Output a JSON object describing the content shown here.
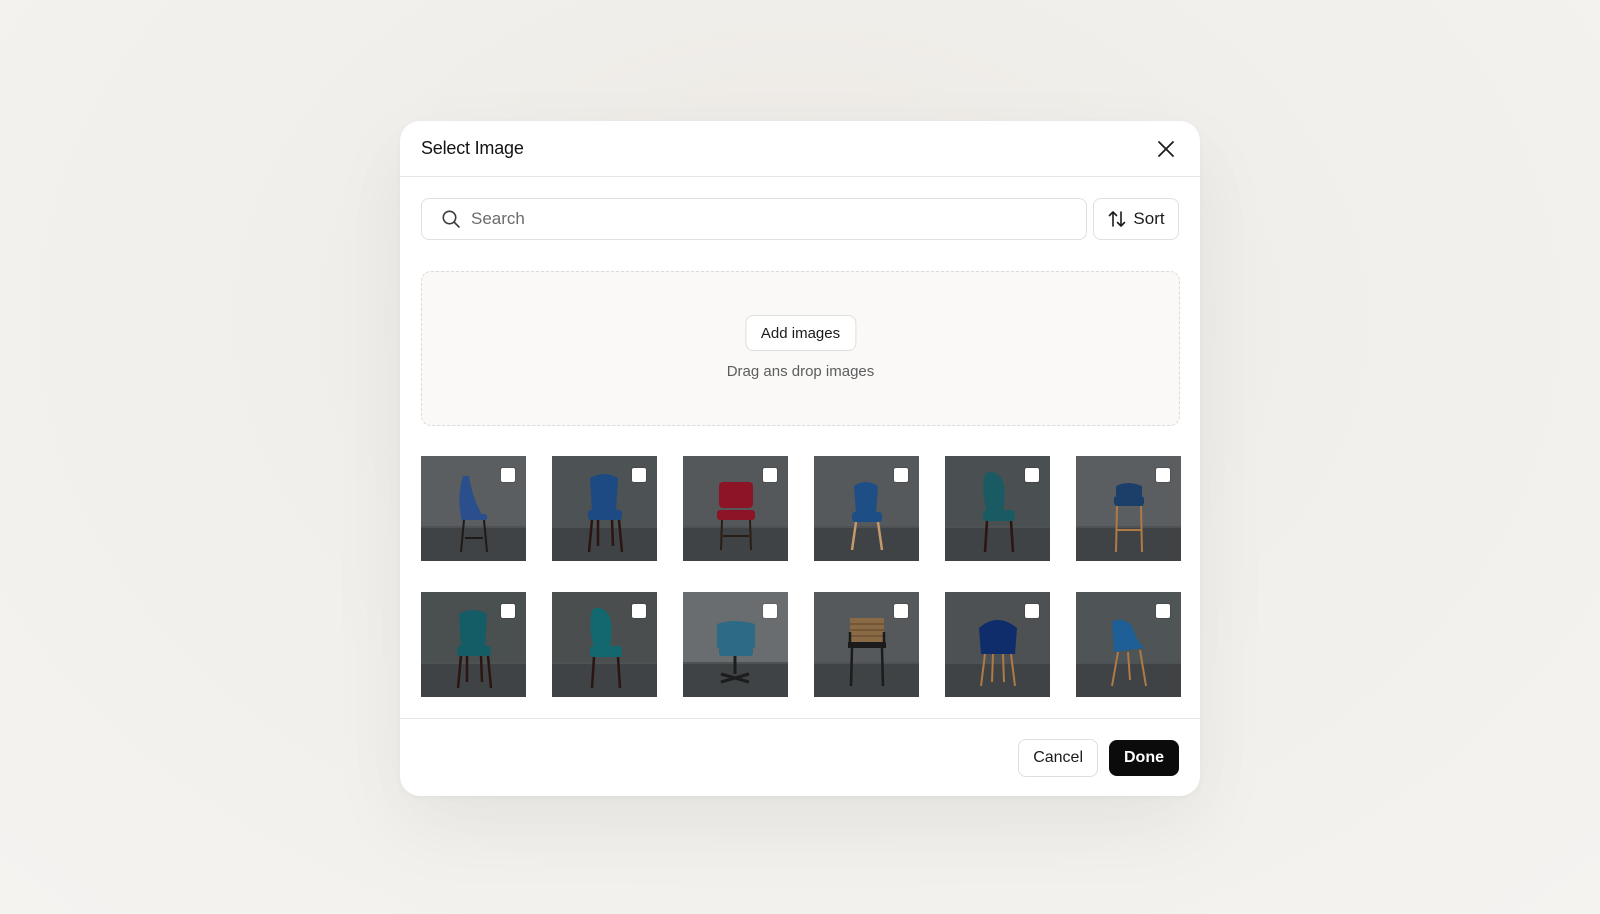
{
  "dialog": {
    "title": "Select Image",
    "search_placeholder": "Search",
    "sort_label": "Sort",
    "add_images_label": "Add images",
    "drop_hint": "Drag ans drop images",
    "cancel_label": "Cancel",
    "done_label": "Done"
  },
  "icons": {
    "close": "close-icon",
    "search": "search-icon",
    "sort": "sort-arrows-icon"
  },
  "images": [
    {
      "chair": "bar-stool",
      "color": "#2a4f8c",
      "leg_color": "#1e1a18",
      "bg": "#5a5e60"
    },
    {
      "chair": "tufted",
      "color": "#1d4a82",
      "leg_color": "#2a1510",
      "bg": "#4d5254"
    },
    {
      "chair": "armless",
      "color": "#8c1426",
      "leg_color": "#2a1d18",
      "bg": "#55585b"
    },
    {
      "chair": "tufted-wood-leg",
      "color": "#1d4f86",
      "leg_color": "#c49a6c",
      "bg": "#55595c"
    },
    {
      "chair": "wingback",
      "color": "#1a5b63",
      "leg_color": "#2a1510",
      "bg": "#4a4f51"
    },
    {
      "chair": "stool",
      "color": "#1c3f6a",
      "leg_color": "#b07a45",
      "bg": "#5a5e61"
    },
    {
      "chair": "tufted",
      "color": "#145c66",
      "leg_color": "#2a1510",
      "bg": "#4a4f50"
    },
    {
      "chair": "wingback",
      "color": "#13686f",
      "leg_color": "#2a1510",
      "bg": "#4a4e4f"
    },
    {
      "chair": "swivel",
      "color": "#2c6a85",
      "leg_color": "#1d1d1d",
      "bg": "#6a6d6f"
    },
    {
      "chair": "slat",
      "color": "#8a6a44",
      "leg_color": "#1b1b1b",
      "bg": "#55595b"
    },
    {
      "chair": "tub",
      "color": "#0f2d6b",
      "leg_color": "#b07a45",
      "bg": "#4d5153"
    },
    {
      "chair": "tub-side",
      "color": "#1d5f96",
      "leg_color": "#b07a45",
      "bg": "#4f5456"
    }
  ]
}
